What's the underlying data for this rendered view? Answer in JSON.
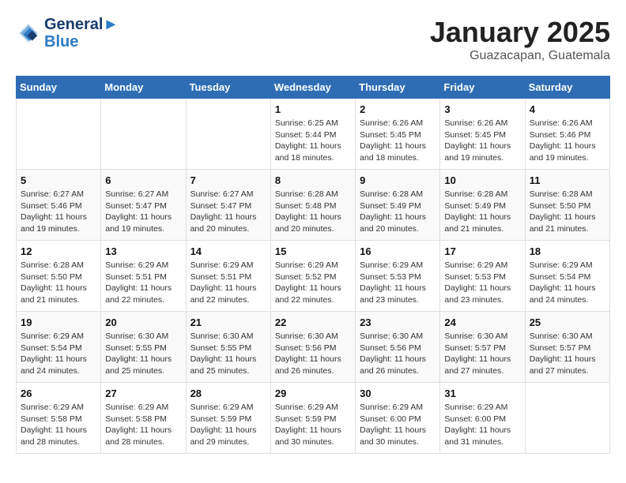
{
  "header": {
    "logo_line1": "General",
    "logo_line2": "Blue",
    "month": "January 2025",
    "location": "Guazacapan, Guatemala"
  },
  "days_of_week": [
    "Sunday",
    "Monday",
    "Tuesday",
    "Wednesday",
    "Thursday",
    "Friday",
    "Saturday"
  ],
  "weeks": [
    [
      {
        "day": "",
        "info": ""
      },
      {
        "day": "",
        "info": ""
      },
      {
        "day": "",
        "info": ""
      },
      {
        "day": "1",
        "info": "Sunrise: 6:25 AM\nSunset: 5:44 PM\nDaylight: 11 hours\nand 18 minutes."
      },
      {
        "day": "2",
        "info": "Sunrise: 6:26 AM\nSunset: 5:45 PM\nDaylight: 11 hours\nand 18 minutes."
      },
      {
        "day": "3",
        "info": "Sunrise: 6:26 AM\nSunset: 5:45 PM\nDaylight: 11 hours\nand 19 minutes."
      },
      {
        "day": "4",
        "info": "Sunrise: 6:26 AM\nSunset: 5:46 PM\nDaylight: 11 hours\nand 19 minutes."
      }
    ],
    [
      {
        "day": "5",
        "info": "Sunrise: 6:27 AM\nSunset: 5:46 PM\nDaylight: 11 hours\nand 19 minutes."
      },
      {
        "day": "6",
        "info": "Sunrise: 6:27 AM\nSunset: 5:47 PM\nDaylight: 11 hours\nand 19 minutes."
      },
      {
        "day": "7",
        "info": "Sunrise: 6:27 AM\nSunset: 5:47 PM\nDaylight: 11 hours\nand 20 minutes."
      },
      {
        "day": "8",
        "info": "Sunrise: 6:28 AM\nSunset: 5:48 PM\nDaylight: 11 hours\nand 20 minutes."
      },
      {
        "day": "9",
        "info": "Sunrise: 6:28 AM\nSunset: 5:49 PM\nDaylight: 11 hours\nand 20 minutes."
      },
      {
        "day": "10",
        "info": "Sunrise: 6:28 AM\nSunset: 5:49 PM\nDaylight: 11 hours\nand 21 minutes."
      },
      {
        "day": "11",
        "info": "Sunrise: 6:28 AM\nSunset: 5:50 PM\nDaylight: 11 hours\nand 21 minutes."
      }
    ],
    [
      {
        "day": "12",
        "info": "Sunrise: 6:28 AM\nSunset: 5:50 PM\nDaylight: 11 hours\nand 21 minutes."
      },
      {
        "day": "13",
        "info": "Sunrise: 6:29 AM\nSunset: 5:51 PM\nDaylight: 11 hours\nand 22 minutes."
      },
      {
        "day": "14",
        "info": "Sunrise: 6:29 AM\nSunset: 5:51 PM\nDaylight: 11 hours\nand 22 minutes."
      },
      {
        "day": "15",
        "info": "Sunrise: 6:29 AM\nSunset: 5:52 PM\nDaylight: 11 hours\nand 22 minutes."
      },
      {
        "day": "16",
        "info": "Sunrise: 6:29 AM\nSunset: 5:53 PM\nDaylight: 11 hours\nand 23 minutes."
      },
      {
        "day": "17",
        "info": "Sunrise: 6:29 AM\nSunset: 5:53 PM\nDaylight: 11 hours\nand 23 minutes."
      },
      {
        "day": "18",
        "info": "Sunrise: 6:29 AM\nSunset: 5:54 PM\nDaylight: 11 hours\nand 24 minutes."
      }
    ],
    [
      {
        "day": "19",
        "info": "Sunrise: 6:29 AM\nSunset: 5:54 PM\nDaylight: 11 hours\nand 24 minutes."
      },
      {
        "day": "20",
        "info": "Sunrise: 6:30 AM\nSunset: 5:55 PM\nDaylight: 11 hours\nand 25 minutes."
      },
      {
        "day": "21",
        "info": "Sunrise: 6:30 AM\nSunset: 5:55 PM\nDaylight: 11 hours\nand 25 minutes."
      },
      {
        "day": "22",
        "info": "Sunrise: 6:30 AM\nSunset: 5:56 PM\nDaylight: 11 hours\nand 26 minutes."
      },
      {
        "day": "23",
        "info": "Sunrise: 6:30 AM\nSunset: 5:56 PM\nDaylight: 11 hours\nand 26 minutes."
      },
      {
        "day": "24",
        "info": "Sunrise: 6:30 AM\nSunset: 5:57 PM\nDaylight: 11 hours\nand 27 minutes."
      },
      {
        "day": "25",
        "info": "Sunrise: 6:30 AM\nSunset: 5:57 PM\nDaylight: 11 hours\nand 27 minutes."
      }
    ],
    [
      {
        "day": "26",
        "info": "Sunrise: 6:29 AM\nSunset: 5:58 PM\nDaylight: 11 hours\nand 28 minutes."
      },
      {
        "day": "27",
        "info": "Sunrise: 6:29 AM\nSunset: 5:58 PM\nDaylight: 11 hours\nand 28 minutes."
      },
      {
        "day": "28",
        "info": "Sunrise: 6:29 AM\nSunset: 5:59 PM\nDaylight: 11 hours\nand 29 minutes."
      },
      {
        "day": "29",
        "info": "Sunrise: 6:29 AM\nSunset: 5:59 PM\nDaylight: 11 hours\nand 30 minutes."
      },
      {
        "day": "30",
        "info": "Sunrise: 6:29 AM\nSunset: 6:00 PM\nDaylight: 11 hours\nand 30 minutes."
      },
      {
        "day": "31",
        "info": "Sunrise: 6:29 AM\nSunset: 6:00 PM\nDaylight: 11 hours\nand 31 minutes."
      },
      {
        "day": "",
        "info": ""
      }
    ]
  ]
}
